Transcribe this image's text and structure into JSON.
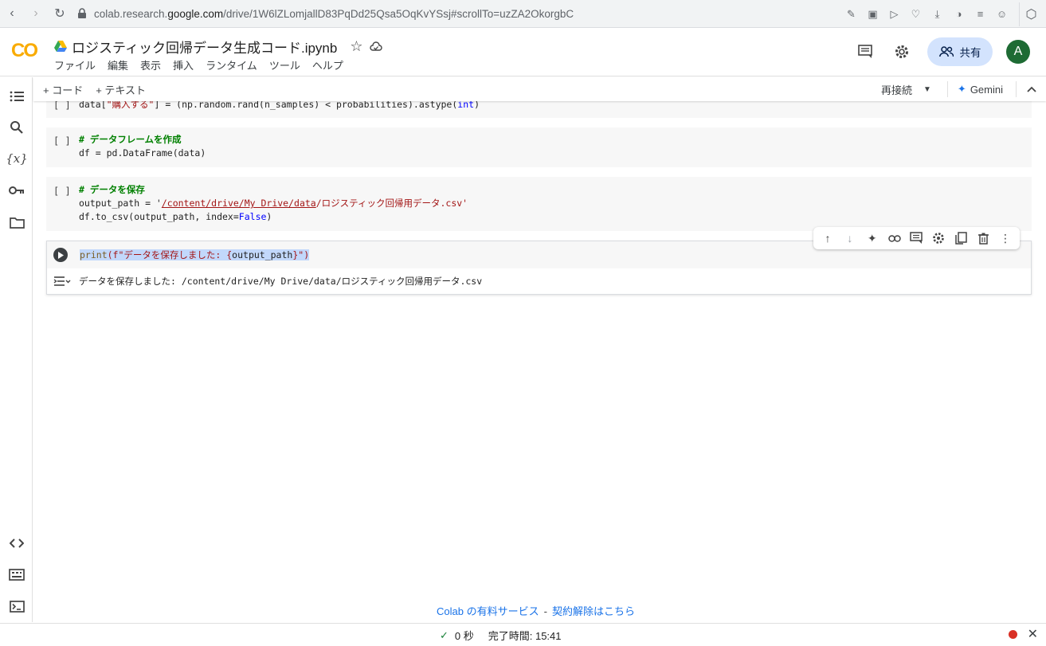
{
  "browser": {
    "url_prefix": "colab.research.",
    "url_host": "google.com",
    "url_path": "/drive/1W6lZLomjallD83PqDd25Qsa5OqKvYSsj#scrollTo=uzZA2OkorgbC"
  },
  "header": {
    "logo": "CO",
    "notebook_title": "ロジスティック回帰データ生成コード.ipynb",
    "menu": [
      "ファイル",
      "編集",
      "表示",
      "挿入",
      "ランタイム",
      "ツール",
      "ヘルプ"
    ],
    "share_label": "共有",
    "avatar_letter": "A"
  },
  "toolbar": {
    "add_code": "+ コード",
    "add_text": "+ テキスト",
    "reconnect": "再接続",
    "gemini": "Gemini"
  },
  "cells": {
    "c1": {
      "bracket": "[ ]",
      "l1_a": "data[",
      "l1_str": "\"購入する\"",
      "l1_b": "] = (np.random.rand(n_samples) < probabilities).astype(",
      "l1_kw": "int",
      "l1_c": ")"
    },
    "c2": {
      "bracket": "[ ]",
      "comment": "# データフレームを作成",
      "line2": "df = pd.DataFrame(data)"
    },
    "c3": {
      "bracket": "[ ]",
      "comment": "# データを保存",
      "l2_a": "output_path = '",
      "l2_path": "/content/drive/My Drive/data",
      "l2_b": "/ロジスティック回帰用データ.csv'",
      "l3_a": "df.to_csv(output_path, index=",
      "l3_kw": "False",
      "l3_b": ")"
    },
    "c4": {
      "code_fn": "print",
      "code_a": "(f\"データを保存しました: {",
      "code_var": "output_path",
      "code_b": "}\")",
      "output": "データを保存しました: /content/drive/My Drive/data/ロジスティック回帰用データ.csv"
    }
  },
  "footer": {
    "promo_link": "Colab の有料サービス",
    "promo_sep": "-",
    "cancel_link": "契約解除はこちら",
    "exec_time": "0 秒",
    "completed": "完了時間: 15:41"
  }
}
